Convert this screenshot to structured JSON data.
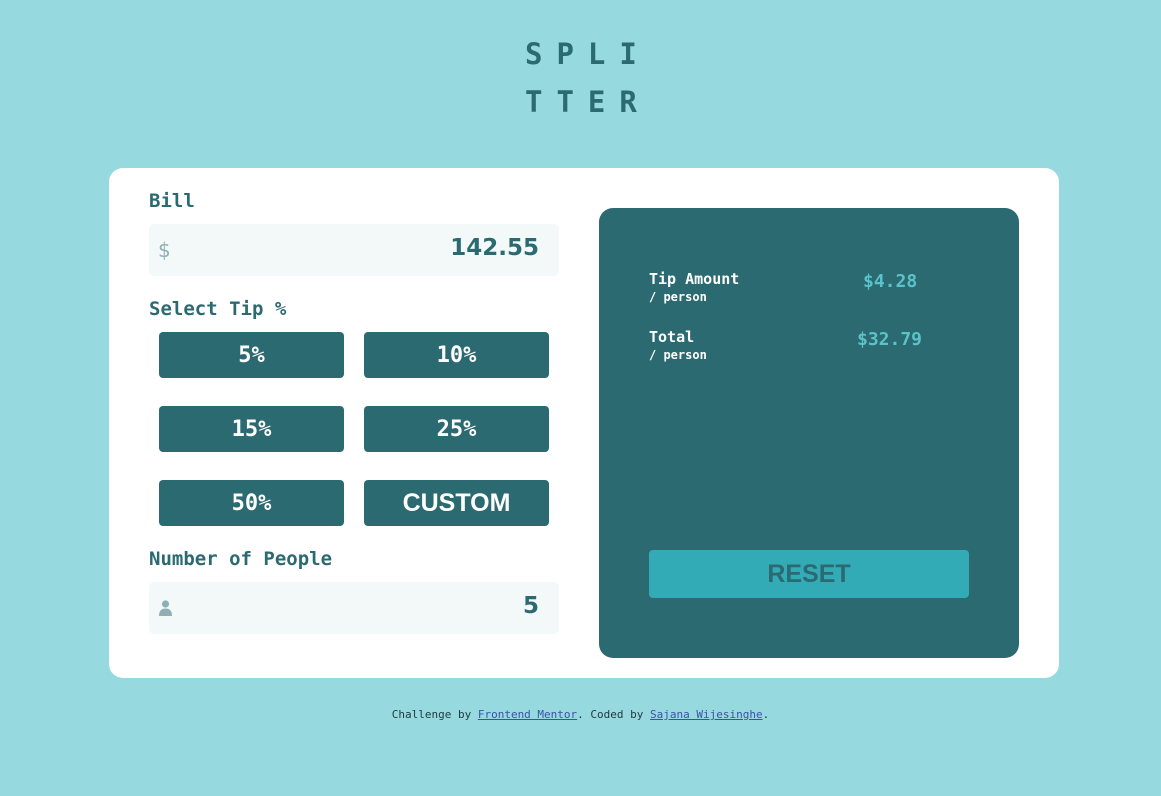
{
  "logo": {
    "line1": "SPLI",
    "line2": "TTER"
  },
  "bill": {
    "label": "Bill",
    "prefix": "$",
    "value": "142.55"
  },
  "tip": {
    "label": "Select Tip %",
    "options": [
      "5%",
      "10%",
      "15%",
      "25%",
      "50%"
    ],
    "custom_label": "CUSTOM"
  },
  "people": {
    "label": "Number of People",
    "icon": "person-icon",
    "value": "5"
  },
  "results": {
    "tip_label": "Tip Amount",
    "tip_sub": "/ person",
    "tip_value": "$4.28",
    "total_label": "Total",
    "total_sub": "/ person",
    "total_value": "$32.79",
    "reset_label": "RESET"
  },
  "footer": {
    "prefix": "Challenge by ",
    "link1": "Frontend Mentor",
    "middle": ". Coded by ",
    "link2": "Sajana Wijesinghe",
    "suffix": "."
  },
  "colors": {
    "background": "#96d9df",
    "dark_teal": "#2c6a72",
    "accent": "#33abb7",
    "result_value": "#5bc2c9",
    "field_bg": "#f3f9f9"
  }
}
